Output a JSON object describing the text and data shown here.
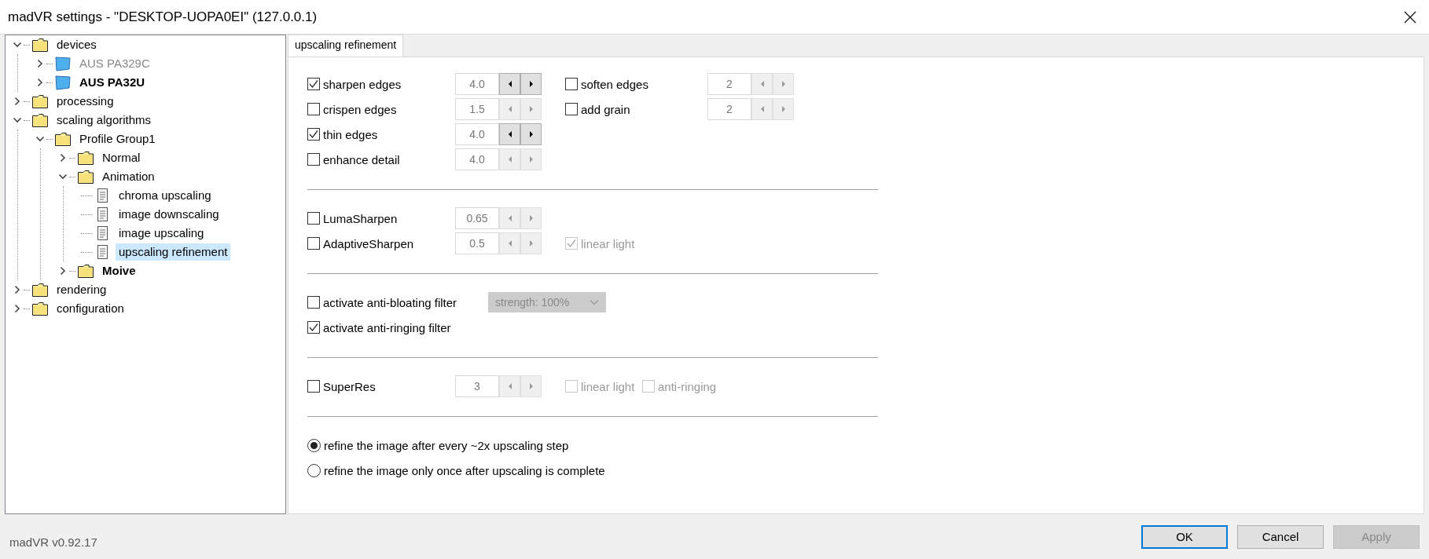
{
  "window": {
    "title": "madVR settings - \"DESKTOP-UOPA0EI\" (127.0.0.1)"
  },
  "tree": [
    {
      "label": "devices",
      "kind": "folder",
      "expanded": true,
      "bold": false,
      "disabled": false,
      "selected": false,
      "children": [
        {
          "label": "AUS PA329C",
          "kind": "monitor",
          "expanded": false,
          "bold": false,
          "disabled": true,
          "selected": false
        },
        {
          "label": "AUS PA32U",
          "kind": "monitor",
          "expanded": false,
          "bold": true,
          "disabled": false,
          "selected": false
        }
      ]
    },
    {
      "label": "processing",
      "kind": "folder",
      "expanded": false,
      "bold": false,
      "disabled": false,
      "selected": false
    },
    {
      "label": "scaling algorithms",
      "kind": "folder",
      "expanded": true,
      "bold": false,
      "disabled": false,
      "selected": false,
      "children": [
        {
          "label": "Profile Group1",
          "kind": "folder",
          "expanded": true,
          "bold": false,
          "disabled": false,
          "selected": false,
          "children": [
            {
              "label": "Normal",
              "kind": "folder",
              "expanded": false,
              "bold": false,
              "disabled": false,
              "selected": false
            },
            {
              "label": "Animation",
              "kind": "folder",
              "expanded": true,
              "bold": false,
              "disabled": false,
              "selected": false,
              "children": [
                {
                  "label": "chroma upscaling",
                  "kind": "page",
                  "bold": false,
                  "disabled": false,
                  "selected": false
                },
                {
                  "label": "image downscaling",
                  "kind": "page",
                  "bold": false,
                  "disabled": false,
                  "selected": false
                },
                {
                  "label": "image upscaling",
                  "kind": "page",
                  "bold": false,
                  "disabled": false,
                  "selected": false
                },
                {
                  "label": "upscaling refinement",
                  "kind": "page",
                  "bold": false,
                  "disabled": false,
                  "selected": true
                }
              ]
            },
            {
              "label": "Moive",
              "kind": "folder",
              "expanded": false,
              "bold": true,
              "disabled": false,
              "selected": false
            }
          ]
        }
      ]
    },
    {
      "label": "rendering",
      "kind": "folder",
      "expanded": false,
      "bold": false,
      "disabled": false,
      "selected": false
    },
    {
      "label": "configuration",
      "kind": "folder",
      "expanded": false,
      "bold": false,
      "disabled": false,
      "selected": false
    }
  ],
  "tabs": [
    {
      "label": "upscaling refinement",
      "selected": true
    }
  ],
  "sections": [
    {
      "rows": [
        [
          {
            "kind": "checkbox",
            "label": "sharpen edges",
            "checked": true,
            "disabled": false
          },
          {
            "kind": "spinner",
            "value": "4.0",
            "disabled": false
          },
          {
            "kind": "checkbox",
            "label": "soften edges",
            "checked": false,
            "disabled": false
          },
          {
            "kind": "spinner",
            "value": "2",
            "disabled": true
          }
        ],
        [
          {
            "kind": "checkbox",
            "label": "crispen edges",
            "checked": false,
            "disabled": false
          },
          {
            "kind": "spinner",
            "value": "1.5",
            "disabled": true
          },
          {
            "kind": "checkbox",
            "label": "add grain",
            "checked": false,
            "disabled": false
          },
          {
            "kind": "spinner",
            "value": "2",
            "disabled": true
          }
        ],
        [
          {
            "kind": "checkbox",
            "label": "thin edges",
            "checked": true,
            "disabled": false
          },
          {
            "kind": "spinner",
            "value": "4.0",
            "disabled": false
          }
        ],
        [
          {
            "kind": "checkbox",
            "label": "enhance detail",
            "checked": false,
            "disabled": false
          },
          {
            "kind": "spinner",
            "value": "4.0",
            "disabled": true
          }
        ]
      ]
    },
    {
      "rows": [
        [
          {
            "kind": "checkbox",
            "label": "LumaSharpen",
            "checked": false,
            "disabled": false
          },
          {
            "kind": "spinner",
            "value": "0.65",
            "disabled": true
          }
        ],
        [
          {
            "kind": "checkbox",
            "label": "AdaptiveSharpen",
            "checked": false,
            "disabled": false
          },
          {
            "kind": "spinner",
            "value": "0.5",
            "disabled": true
          },
          {
            "kind": "checkbox",
            "label": "linear light",
            "checked": true,
            "disabled": true
          }
        ]
      ]
    },
    {
      "rows": [
        [
          {
            "kind": "checkbox",
            "label": "activate anti-bloating filter",
            "checked": false,
            "disabled": false
          },
          {
            "kind": "dropdown",
            "value": "strength: 100%",
            "disabled": true
          }
        ],
        [
          {
            "kind": "checkbox",
            "label": "activate anti-ringing filter",
            "checked": true,
            "disabled": false
          }
        ]
      ]
    },
    {
      "rows": [
        [
          {
            "kind": "checkbox",
            "label": "SuperRes",
            "checked": false,
            "disabled": false
          },
          {
            "kind": "spinner",
            "value": "3",
            "disabled": true
          },
          {
            "kind": "checkbox",
            "label": "linear light",
            "checked": false,
            "disabled": true
          },
          {
            "kind": "checkbox",
            "label": "anti-ringing",
            "checked": false,
            "disabled": true
          }
        ]
      ]
    },
    {
      "rows": [
        [
          {
            "kind": "radio",
            "label": "refine the image after every ~2x upscaling step",
            "selected": true
          }
        ],
        [
          {
            "kind": "radio",
            "label": "refine the image only once after upscaling is complete",
            "selected": false
          }
        ]
      ]
    }
  ],
  "footer": {
    "version": "madVR v0.92.17"
  },
  "buttons": [
    {
      "label": "OK",
      "focused": true,
      "disabled": false
    },
    {
      "label": "Cancel",
      "focused": false,
      "disabled": false
    },
    {
      "label": "Apply",
      "focused": false,
      "disabled": true
    }
  ]
}
